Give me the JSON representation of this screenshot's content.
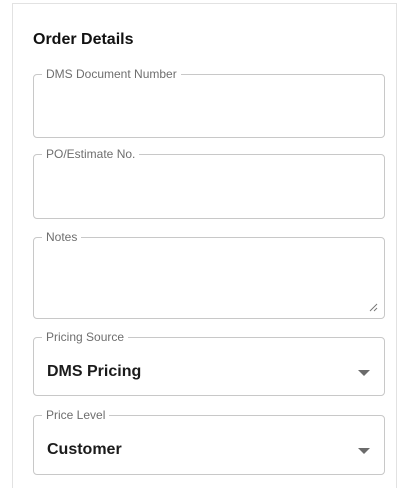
{
  "order_details": {
    "title": "Order Details",
    "fields": {
      "dms_document_number": {
        "label": "DMS Document Number",
        "value": ""
      },
      "po_estimate": {
        "label": "PO/Estimate No.",
        "value": ""
      },
      "notes": {
        "label": "Notes",
        "value": ""
      },
      "pricing_source": {
        "label": "Pricing Source",
        "value": "DMS Pricing",
        "icon": "chevron-down-icon"
      },
      "price_level": {
        "label": "Price Level",
        "value": "Customer",
        "icon": "chevron-down-icon"
      }
    }
  },
  "colors": {
    "border": "#c8c8c8",
    "label": "#6e6e6e",
    "text": "#1b1b1b"
  }
}
